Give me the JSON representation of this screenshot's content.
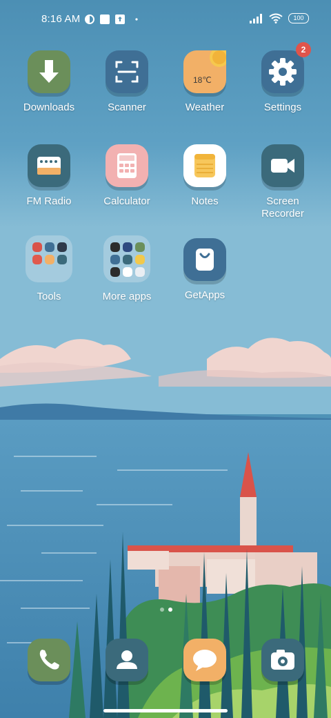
{
  "status": {
    "time": "8:16 AM",
    "battery": "100"
  },
  "apps": {
    "downloads": "Downloads",
    "scanner": "Scanner",
    "weather": "Weather",
    "weather_temp": "18℃",
    "settings": "Settings",
    "settings_badge": "2",
    "fm_radio": "FM Radio",
    "calculator": "Calculator",
    "notes": "Notes",
    "screen_recorder_1": "Screen",
    "screen_recorder_2": "Recorder",
    "tools": "Tools",
    "more_apps": "More apps",
    "getapps": "GetApps"
  },
  "dock": {
    "icons": [
      "phone-icon",
      "contacts-icon",
      "messages-icon",
      "camera-icon"
    ]
  },
  "colors": {
    "green": "#6b8f5a",
    "blue": "#3f6f95",
    "orange": "#f2b067",
    "teal": "#3b6a7b",
    "pink": "#f2b1b1",
    "badge": "#e0544b"
  }
}
